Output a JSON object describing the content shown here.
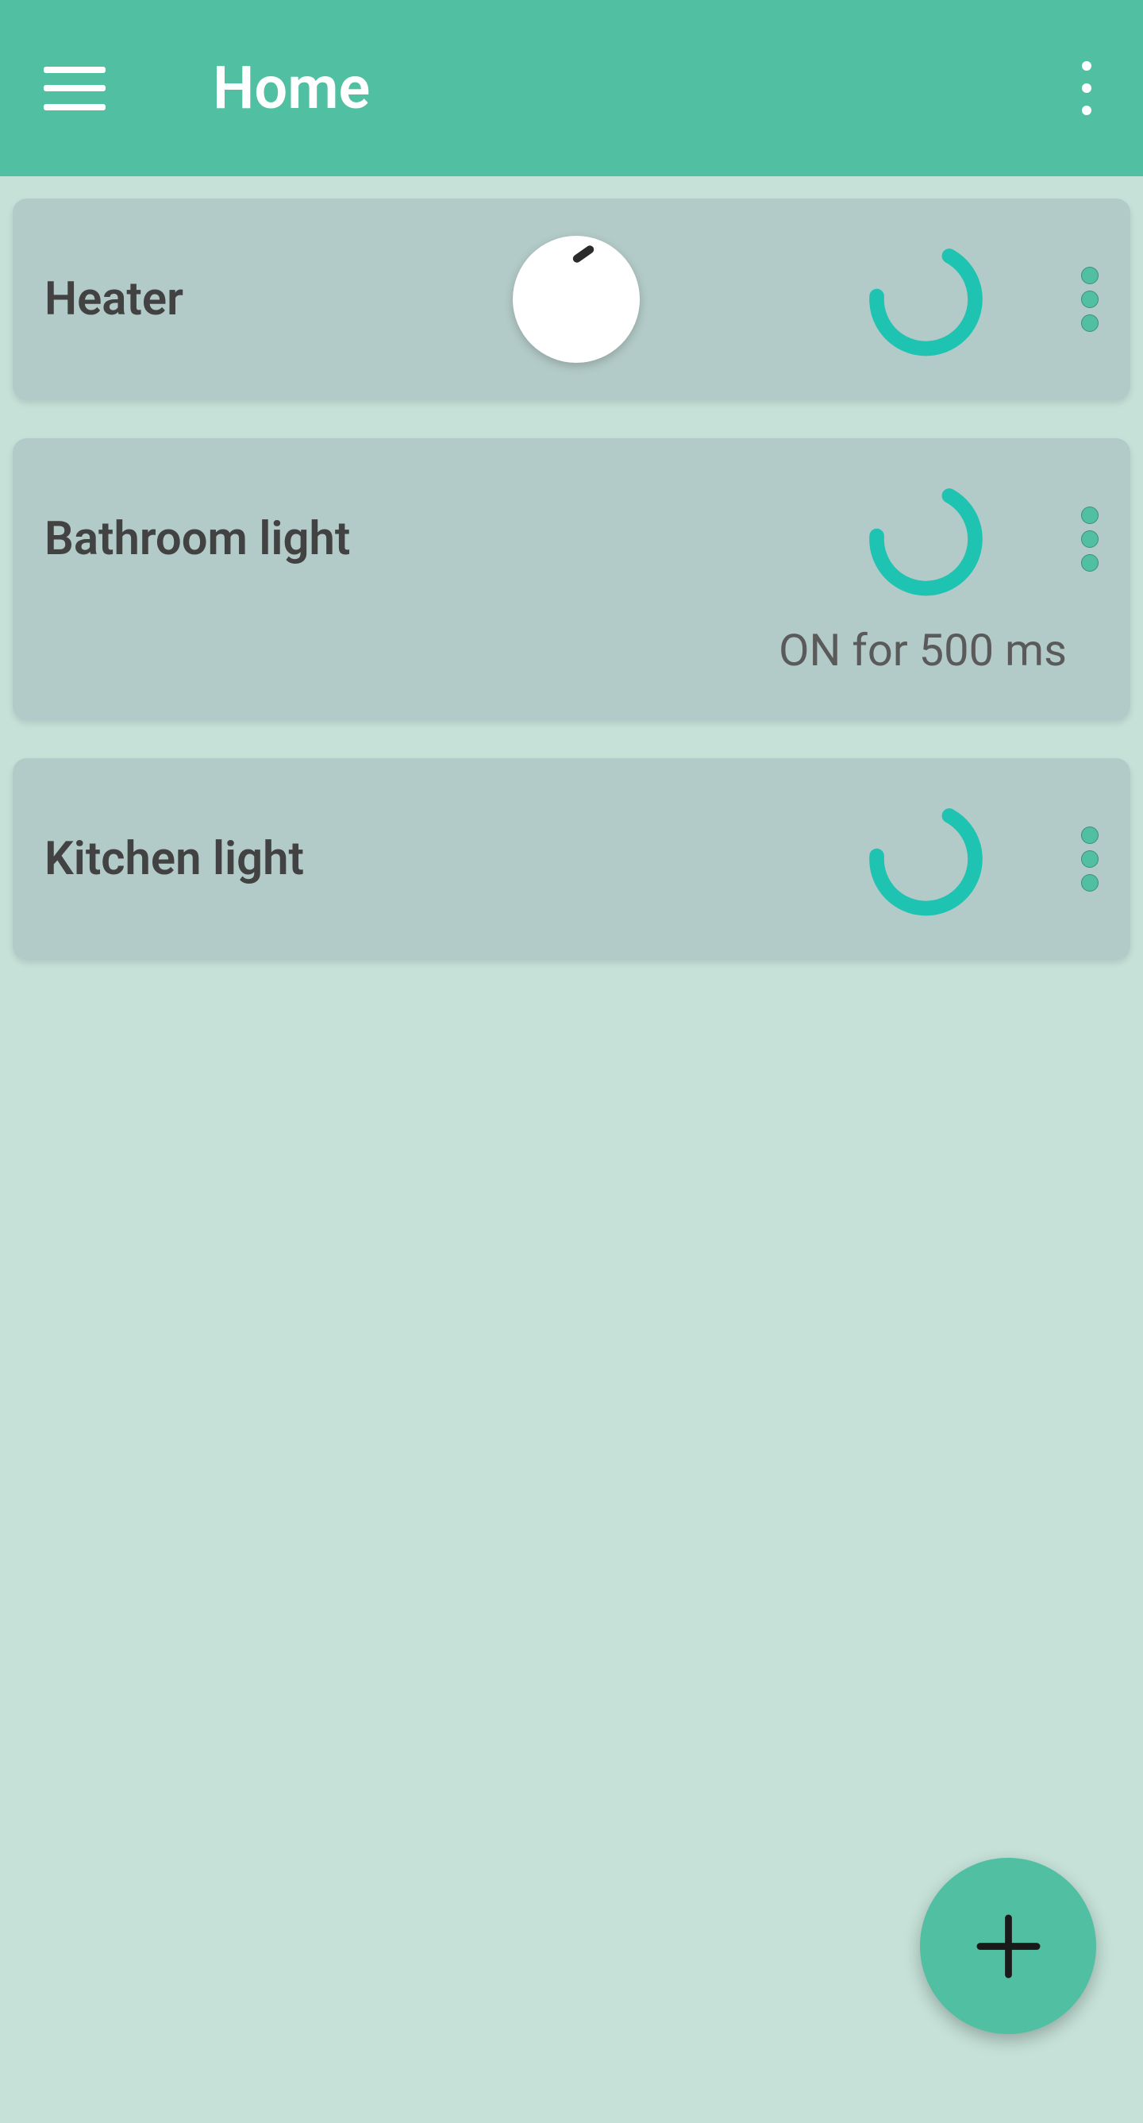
{
  "header": {
    "title": "Home"
  },
  "devices": [
    {
      "label": "Heater",
      "hasKnob": true,
      "status": null
    },
    {
      "label": "Bathroom light",
      "hasKnob": false,
      "status": "ON for 500 ms"
    },
    {
      "label": "Kitchen light",
      "hasKnob": false,
      "status": null
    }
  ],
  "colors": {
    "primary": "#51bfa1",
    "background": "#c5e1d8",
    "card": "#b3cbc8",
    "spinner": "#1fc3b1"
  }
}
